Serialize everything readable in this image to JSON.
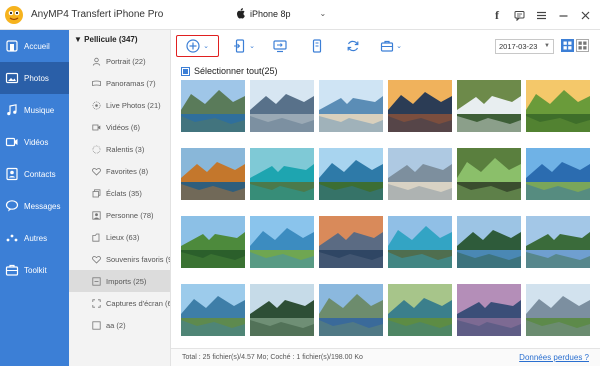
{
  "app": {
    "title": "AnyMP4 Transfert iPhone Pro",
    "device_name": "iPhone 8p",
    "window_controls": [
      "facebook-icon",
      "feedback-icon",
      "menu-icon",
      "minimize-icon",
      "close-icon"
    ]
  },
  "sidebar": {
    "items": [
      {
        "label": "Accueil",
        "icon": "home-icon",
        "active": false
      },
      {
        "label": "Photos",
        "icon": "photos-icon",
        "active": true
      },
      {
        "label": "Musique",
        "icon": "music-icon",
        "active": false
      },
      {
        "label": "Vidéos",
        "icon": "video-icon",
        "active": false
      },
      {
        "label": "Contacts",
        "icon": "contacts-icon",
        "active": false
      },
      {
        "label": "Messages",
        "icon": "messages-icon",
        "active": false
      },
      {
        "label": "Autres",
        "icon": "more-icon",
        "active": false
      },
      {
        "label": "Toolkit",
        "icon": "toolkit-icon",
        "active": false
      }
    ]
  },
  "tree": {
    "header": "Pellicule (347)",
    "items": [
      {
        "label": "Portrait (22)",
        "icon": "portrait-icon"
      },
      {
        "label": "Panoramas (7)",
        "icon": "panorama-icon"
      },
      {
        "label": "Live Photos (21)",
        "icon": "live-photo-icon"
      },
      {
        "label": "Vidéos (6)",
        "icon": "video-icon"
      },
      {
        "label": "Ralentis (3)",
        "icon": "slow-motion-icon"
      },
      {
        "label": "Favorites (8)",
        "icon": "heart-icon"
      },
      {
        "label": "Éclats (35)",
        "icon": "burst-icon"
      },
      {
        "label": "Personne (78)",
        "icon": "person-icon"
      },
      {
        "label": "Lieux (63)",
        "icon": "place-icon"
      },
      {
        "label": "Souvenirs favoris (94",
        "icon": "heart-icon"
      },
      {
        "label": "Imports (25)",
        "icon": "imports-icon",
        "active": true
      },
      {
        "label": "Captures d'écran (60",
        "icon": "screenshot-icon"
      },
      {
        "label": "aa (2)",
        "icon": "folder-icon"
      }
    ]
  },
  "toolbar": {
    "buttons": [
      "add-icon",
      "export-to-device-icon",
      "export-to-pc-icon",
      "itunes-icon",
      "refresh-icon",
      "toolbox-icon"
    ],
    "date_value": "2017-03-23"
  },
  "content": {
    "select_all_label": "Sélectionner tout(25)",
    "status_text": "Total : 25 fichier(s)/4.57 Mo; Coché : 1 fichier(s)/198.00 Ko",
    "lost_data_link": "Données perdues ?"
  },
  "colors": {
    "sidebar_bg": "#3c7fd6",
    "sidebar_active": "#2a5fa8",
    "accent_red": "#e02020",
    "link_blue": "#2a6fd0"
  },
  "photos": [
    {
      "theme": "mountain-lake"
    },
    {
      "theme": "rocks-water"
    },
    {
      "theme": "seaside-cliffs"
    },
    {
      "theme": "sunset-lake"
    },
    {
      "theme": "waterfall"
    },
    {
      "theme": "green-field"
    },
    {
      "theme": "autumn-trees"
    },
    {
      "theme": "turquoise-sea"
    },
    {
      "theme": "palm-beach"
    },
    {
      "theme": "boulders-shore"
    },
    {
      "theme": "mossy-rocks"
    },
    {
      "theme": "blue-lake"
    },
    {
      "theme": "green-mountains"
    },
    {
      "theme": "coastline"
    },
    {
      "theme": "mountain-reflection"
    },
    {
      "theme": "turquoise-lake"
    },
    {
      "theme": "forest-lake"
    },
    {
      "theme": "lake-trees"
    },
    {
      "theme": "alpine-reflection"
    },
    {
      "theme": "pine-forest"
    },
    {
      "theme": "mountain-shore"
    },
    {
      "theme": "aerial-lake"
    },
    {
      "theme": "river-dusk"
    },
    {
      "theme": "snowy-peaks"
    }
  ]
}
